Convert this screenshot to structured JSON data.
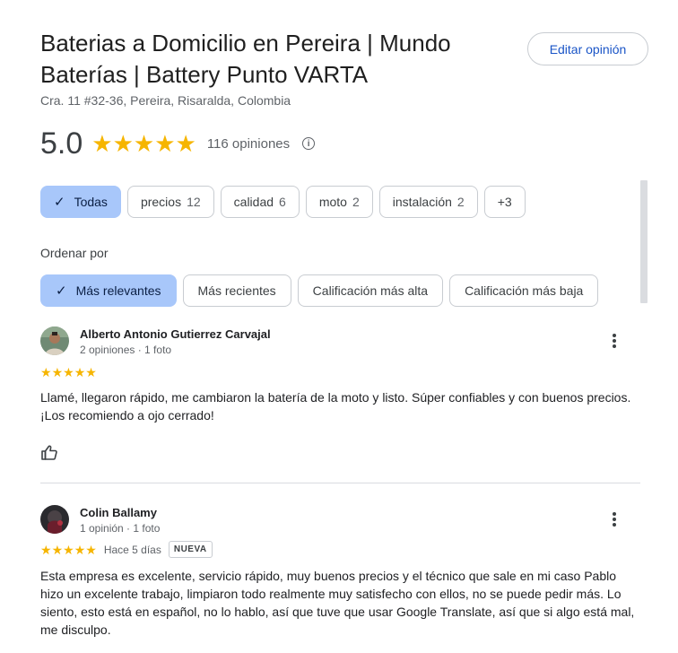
{
  "place": {
    "title": "Baterias a Domicilio en Pereira | Mundo Baterías | Battery Punto VARTA",
    "address": "Cra. 11 #32-36, Pereira, Risaralda, Colombia",
    "edit_label": "Editar opinión"
  },
  "summary": {
    "rating": "5.0",
    "stars": 5,
    "count_label": "116 opiniones",
    "star_color": "#f6b500"
  },
  "filters": [
    {
      "label": "Todas",
      "count": "",
      "active": true
    },
    {
      "label": "precios",
      "count": "12",
      "active": false
    },
    {
      "label": "calidad",
      "count": "6",
      "active": false
    },
    {
      "label": "moto",
      "count": "2",
      "active": false
    },
    {
      "label": "instalación",
      "count": "2",
      "active": false
    },
    {
      "label": "+3",
      "count": "",
      "active": false
    }
  ],
  "sort": {
    "label": "Ordenar por",
    "options": [
      {
        "label": "Más relevantes",
        "active": true
      },
      {
        "label": "Más recientes",
        "active": false
      },
      {
        "label": "Calificación más alta",
        "active": false
      },
      {
        "label": "Calificación más baja",
        "active": false
      }
    ]
  },
  "reviews": [
    {
      "name": "Alberto Antonio Gutierrez Carvajal",
      "meta": "2 opiniones · 1 foto",
      "stars": 5,
      "time": "",
      "badge": "",
      "text": "Llamé, llegaron rápido, me cambiaron la batería de la moto y listo. Súper confiables y con buenos precios. ¡Los recomiendo a ojo cerrado!"
    },
    {
      "name": "Colin Ballamy",
      "meta": "1 opinión · 1 foto",
      "stars": 5,
      "time": "Hace 5 días",
      "badge": "NUEVA",
      "text": "Esta empresa es excelente, servicio rápido, muy buenos precios y el técnico que sale en mi caso Pablo hizo un excelente trabajo, limpiaron todo realmente muy satisfecho con ellos, no se puede pedir más. Lo siento, esto está en español, no lo hablo, así que tuve que usar Google Translate, así que si algo está mal, me disculpo."
    }
  ]
}
